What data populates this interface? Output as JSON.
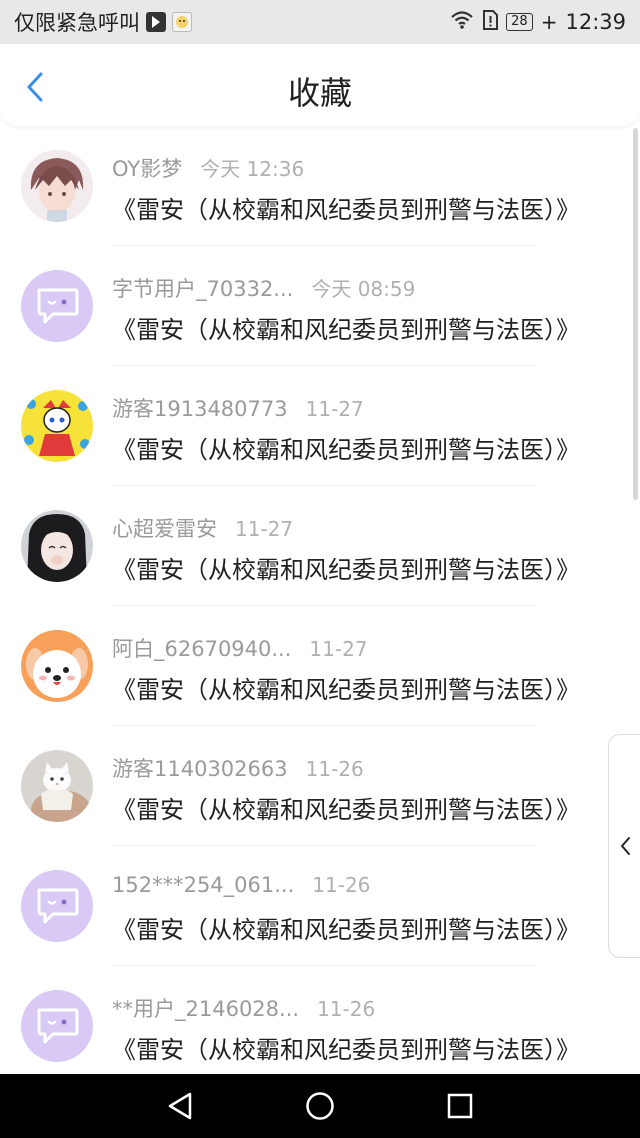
{
  "status_bar": {
    "carrier_text": "仅限紧急呼叫",
    "battery_level": "28",
    "time": "12:39"
  },
  "header": {
    "title": "收藏",
    "back_icon": "chevron-left-icon",
    "accent_color": "#3a8ee6"
  },
  "items": [
    {
      "username": "OY影梦",
      "time": "今天 12:36",
      "excerpt": "《雷安（从校霸和风纪委员到刑警与法医）》",
      "avatar": "anime-boy-avatar"
    },
    {
      "username": "字节用户_70332...",
      "time": "今天 08:59",
      "excerpt": "《雷安（从校霸和风纪委员到刑警与法医）》",
      "avatar": "default-chat-avatar"
    },
    {
      "username": "游客1913480773",
      "time": "11-27",
      "excerpt": "《雷安（从校霸和风纪委员到刑警与法医）》",
      "avatar": "cartoon-girl-avatar"
    },
    {
      "username": "心超爱雷安",
      "time": "11-27",
      "excerpt": "《雷安（从校霸和风纪委员到刑警与法医）》",
      "avatar": "dark-hair-girl-avatar"
    },
    {
      "username": "阿白_62670940...",
      "time": "11-27",
      "excerpt": "《雷安（从校霸和风纪委员到刑警与法医）》",
      "avatar": "cute-puppy-avatar"
    },
    {
      "username": "游客1140302663",
      "time": "11-26",
      "excerpt": "《雷安（从校霸和风纪委员到刑警与法医）》",
      "avatar": "cat-photo-avatar"
    },
    {
      "username": "152***254_061...",
      "time": "11-26",
      "excerpt": "《雷安（从校霸和风纪委员到刑警与法医）》",
      "avatar": "default-chat-avatar"
    },
    {
      "username": "**用户_2146028...",
      "time": "11-26",
      "excerpt": "《雷安（从校霸和风纪委员到刑警与法医）》",
      "avatar": "default-chat-avatar"
    }
  ],
  "side_tab": {
    "icon": "chevron-left-icon"
  },
  "nav_bar": {
    "back_icon": "triangle-back-icon",
    "home_icon": "circle-home-icon",
    "recents_icon": "square-recents-icon"
  }
}
